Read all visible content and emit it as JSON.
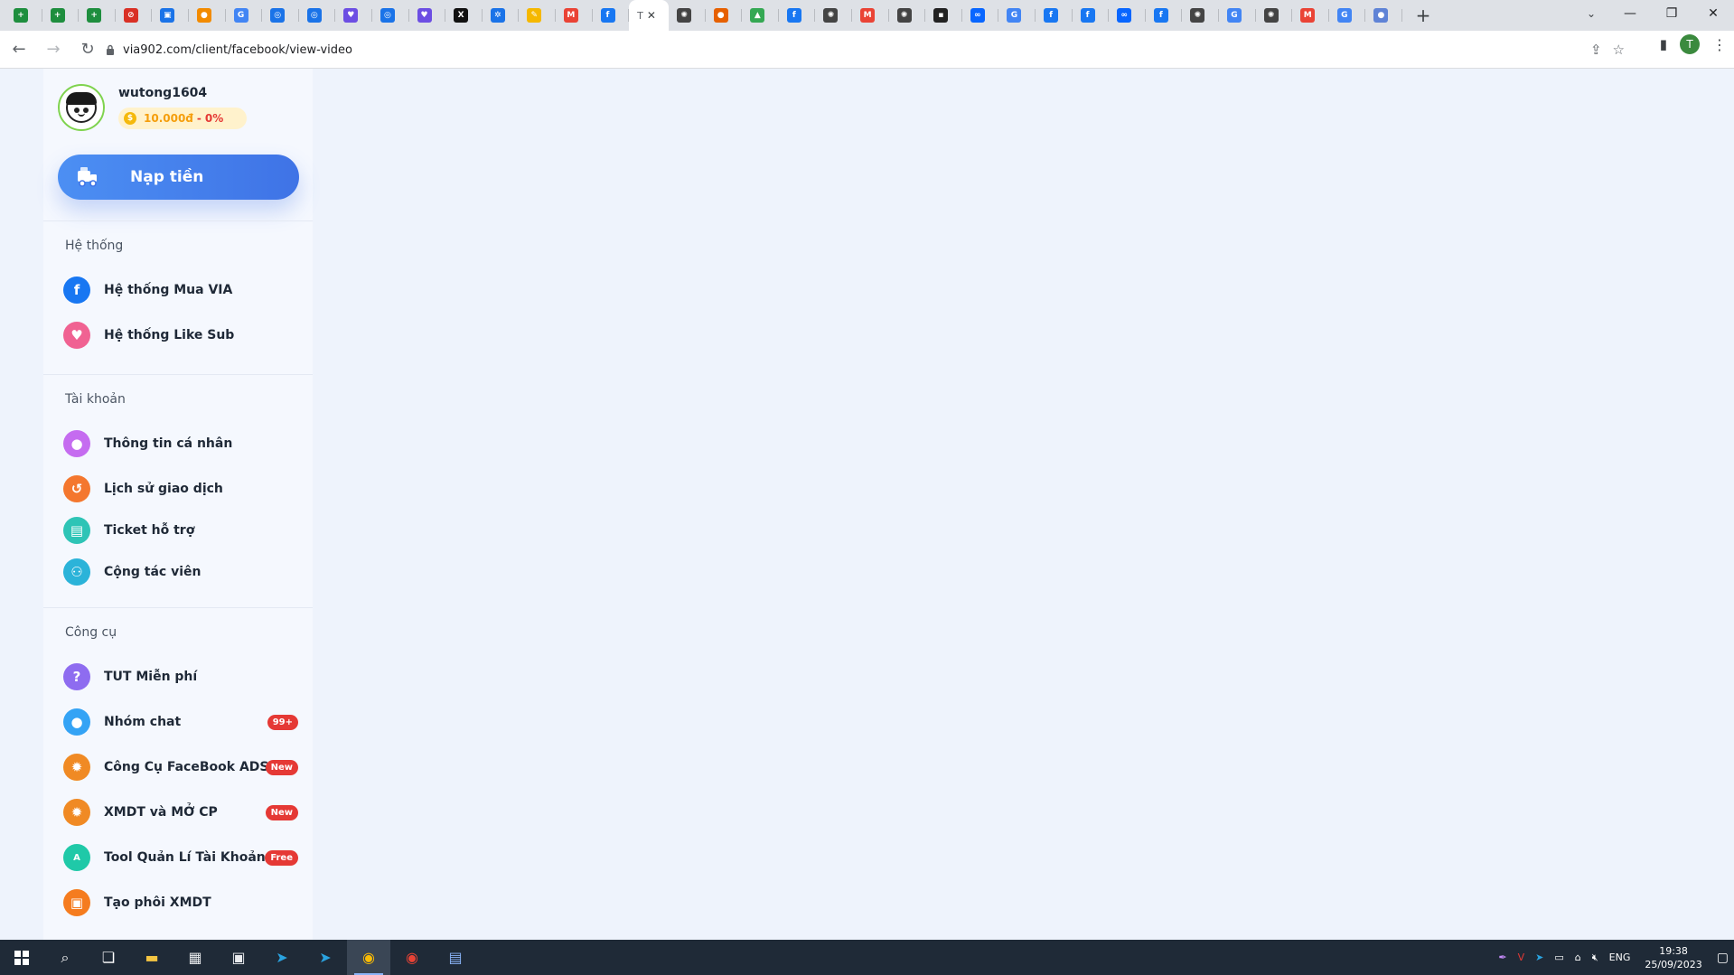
{
  "browser": {
    "tabs": [
      {
        "icon": "sheets-icon",
        "color": "#1e8e3e",
        "glyph": "+"
      },
      {
        "icon": "sheets-icon",
        "color": "#1e8e3e",
        "glyph": "+"
      },
      {
        "icon": "sheets-icon",
        "color": "#1e8e3e",
        "glyph": "+"
      },
      {
        "icon": "no-entry-icon",
        "color": "#d93025",
        "glyph": "⊘"
      },
      {
        "icon": "image-icon",
        "color": "#1a73e8",
        "glyph": "▣"
      },
      {
        "icon": "fox-icon",
        "color": "#f28b00",
        "glyph": "●"
      },
      {
        "icon": "translate-icon",
        "color": "#4285f4",
        "glyph": "G"
      },
      {
        "icon": "globe-icon",
        "color": "#1a73e8",
        "glyph": "◎"
      },
      {
        "icon": "globe-icon",
        "color": "#1a73e8",
        "glyph": "◎"
      },
      {
        "icon": "chat-icon",
        "color": "#6c4ee3",
        "glyph": "♥"
      },
      {
        "icon": "globe-icon",
        "color": "#1a73e8",
        "glyph": "◎"
      },
      {
        "icon": "chat-icon",
        "color": "#6c4ee3",
        "glyph": "♥"
      },
      {
        "icon": "x-icon",
        "color": "#111111",
        "glyph": "X"
      },
      {
        "icon": "gear-icon",
        "color": "#1a73e8",
        "glyph": "✲"
      },
      {
        "icon": "pen-icon",
        "color": "#f5b800",
        "glyph": "✎"
      },
      {
        "icon": "gmail-icon",
        "color": "#ea4335",
        "glyph": "M"
      },
      {
        "icon": "facebook-icon",
        "color": "#1877f2",
        "glyph": "f"
      },
      {
        "icon": "meta-icon",
        "color": "#0866ff",
        "glyph": "∞"
      },
      {
        "icon": "chatgpt-icon",
        "color": "#444444",
        "glyph": "✺"
      },
      {
        "icon": "firefox-icon",
        "color": "#e66000",
        "glyph": "●"
      },
      {
        "icon": "drive-icon",
        "color": "#34a853",
        "glyph": "▲"
      },
      {
        "icon": "facebook-icon",
        "color": "#1877f2",
        "glyph": "f"
      },
      {
        "icon": "chatgpt-icon",
        "color": "#444444",
        "glyph": "✺"
      },
      {
        "icon": "gmail-icon",
        "color": "#ea4335",
        "glyph": "M"
      },
      {
        "icon": "chatgpt-icon",
        "color": "#444444",
        "glyph": "✺"
      },
      {
        "icon": "dark-icon",
        "color": "#222222",
        "glyph": "▪"
      },
      {
        "icon": "meta-icon",
        "color": "#0866ff",
        "glyph": "∞"
      },
      {
        "icon": "google-icon",
        "color": "#4285f4",
        "glyph": "G"
      },
      {
        "icon": "facebook-icon",
        "color": "#1877f2",
        "glyph": "f"
      },
      {
        "icon": "facebook-icon",
        "color": "#1877f2",
        "glyph": "f"
      },
      {
        "icon": "meta-icon",
        "color": "#0866ff",
        "glyph": "∞"
      },
      {
        "icon": "facebook-icon",
        "color": "#1877f2",
        "glyph": "f"
      },
      {
        "icon": "chatgpt-icon",
        "color": "#444444",
        "glyph": "✺"
      },
      {
        "icon": "google-icon",
        "color": "#4285f4",
        "glyph": "G"
      },
      {
        "icon": "chatgpt-icon",
        "color": "#444444",
        "glyph": "✺"
      },
      {
        "icon": "gmail-icon",
        "color": "#ea4335",
        "glyph": "M"
      },
      {
        "icon": "google-icon",
        "color": "#4285f4",
        "glyph": "G"
      },
      {
        "icon": "info-icon",
        "color": "#5f83d6",
        "glyph": "●"
      }
    ],
    "active_tab_index": 17,
    "active_tab_label": "T",
    "url": "via902.com/client/facebook/view-video",
    "profile_initial": "T"
  },
  "user": {
    "name": "wutong1604",
    "balance": "10.000đ",
    "separator": "-",
    "percent": "0%"
  },
  "deposit_label": "Nạp tiền",
  "sections": {
    "system": {
      "title": "Hệ thống",
      "items": [
        {
          "label": "Hệ thống Mua VIA",
          "icon": "facebook-icon",
          "color": "#1877f2"
        },
        {
          "label": "Hệ thống Like Sub",
          "icon": "heart-icon",
          "color": "#f06292"
        }
      ]
    },
    "account": {
      "title": "Tài khoản",
      "items": [
        {
          "label": "Thông tin cá nhân",
          "icon": "user-icon",
          "color": "#c56cf0"
        },
        {
          "label": "Lịch sử giao dịch",
          "icon": "history-icon",
          "color": "#f4772e"
        },
        {
          "label": "Ticket hỗ trợ",
          "icon": "ticket-icon",
          "color": "#2ec4b6"
        },
        {
          "label": "Cộng tác viên",
          "icon": "team-icon",
          "color": "#2bb3d9"
        }
      ]
    },
    "tools": {
      "title": "Công cụ",
      "items": [
        {
          "label": "TUT Miễn phí",
          "icon": "question-icon",
          "color": "#8e6cf0",
          "badge": ""
        },
        {
          "label": "Nhóm chat",
          "icon": "chat-bubble-icon",
          "color": "#34a3f5",
          "badge": "99+"
        },
        {
          "label": "Công Cụ FaceBook ADS",
          "icon": "gear-people-icon",
          "color": "#f08a24",
          "badge": "New"
        },
        {
          "label": "XMDT và MỞ CP",
          "icon": "gear-people-icon",
          "color": "#f08a24",
          "badge": "New"
        },
        {
          "label": "Tool Quản Lí Tài Khoản",
          "icon": "ads-icon",
          "color": "#1fc9a8",
          "badge": "Free"
        },
        {
          "label": "Tạo phôi XMDT",
          "icon": "id-card-icon",
          "color": "#f57c1f",
          "badge": ""
        }
      ]
    }
  },
  "taskbar": {
    "time": "19:38",
    "date": "25/09/2023",
    "lang": "ENG"
  }
}
